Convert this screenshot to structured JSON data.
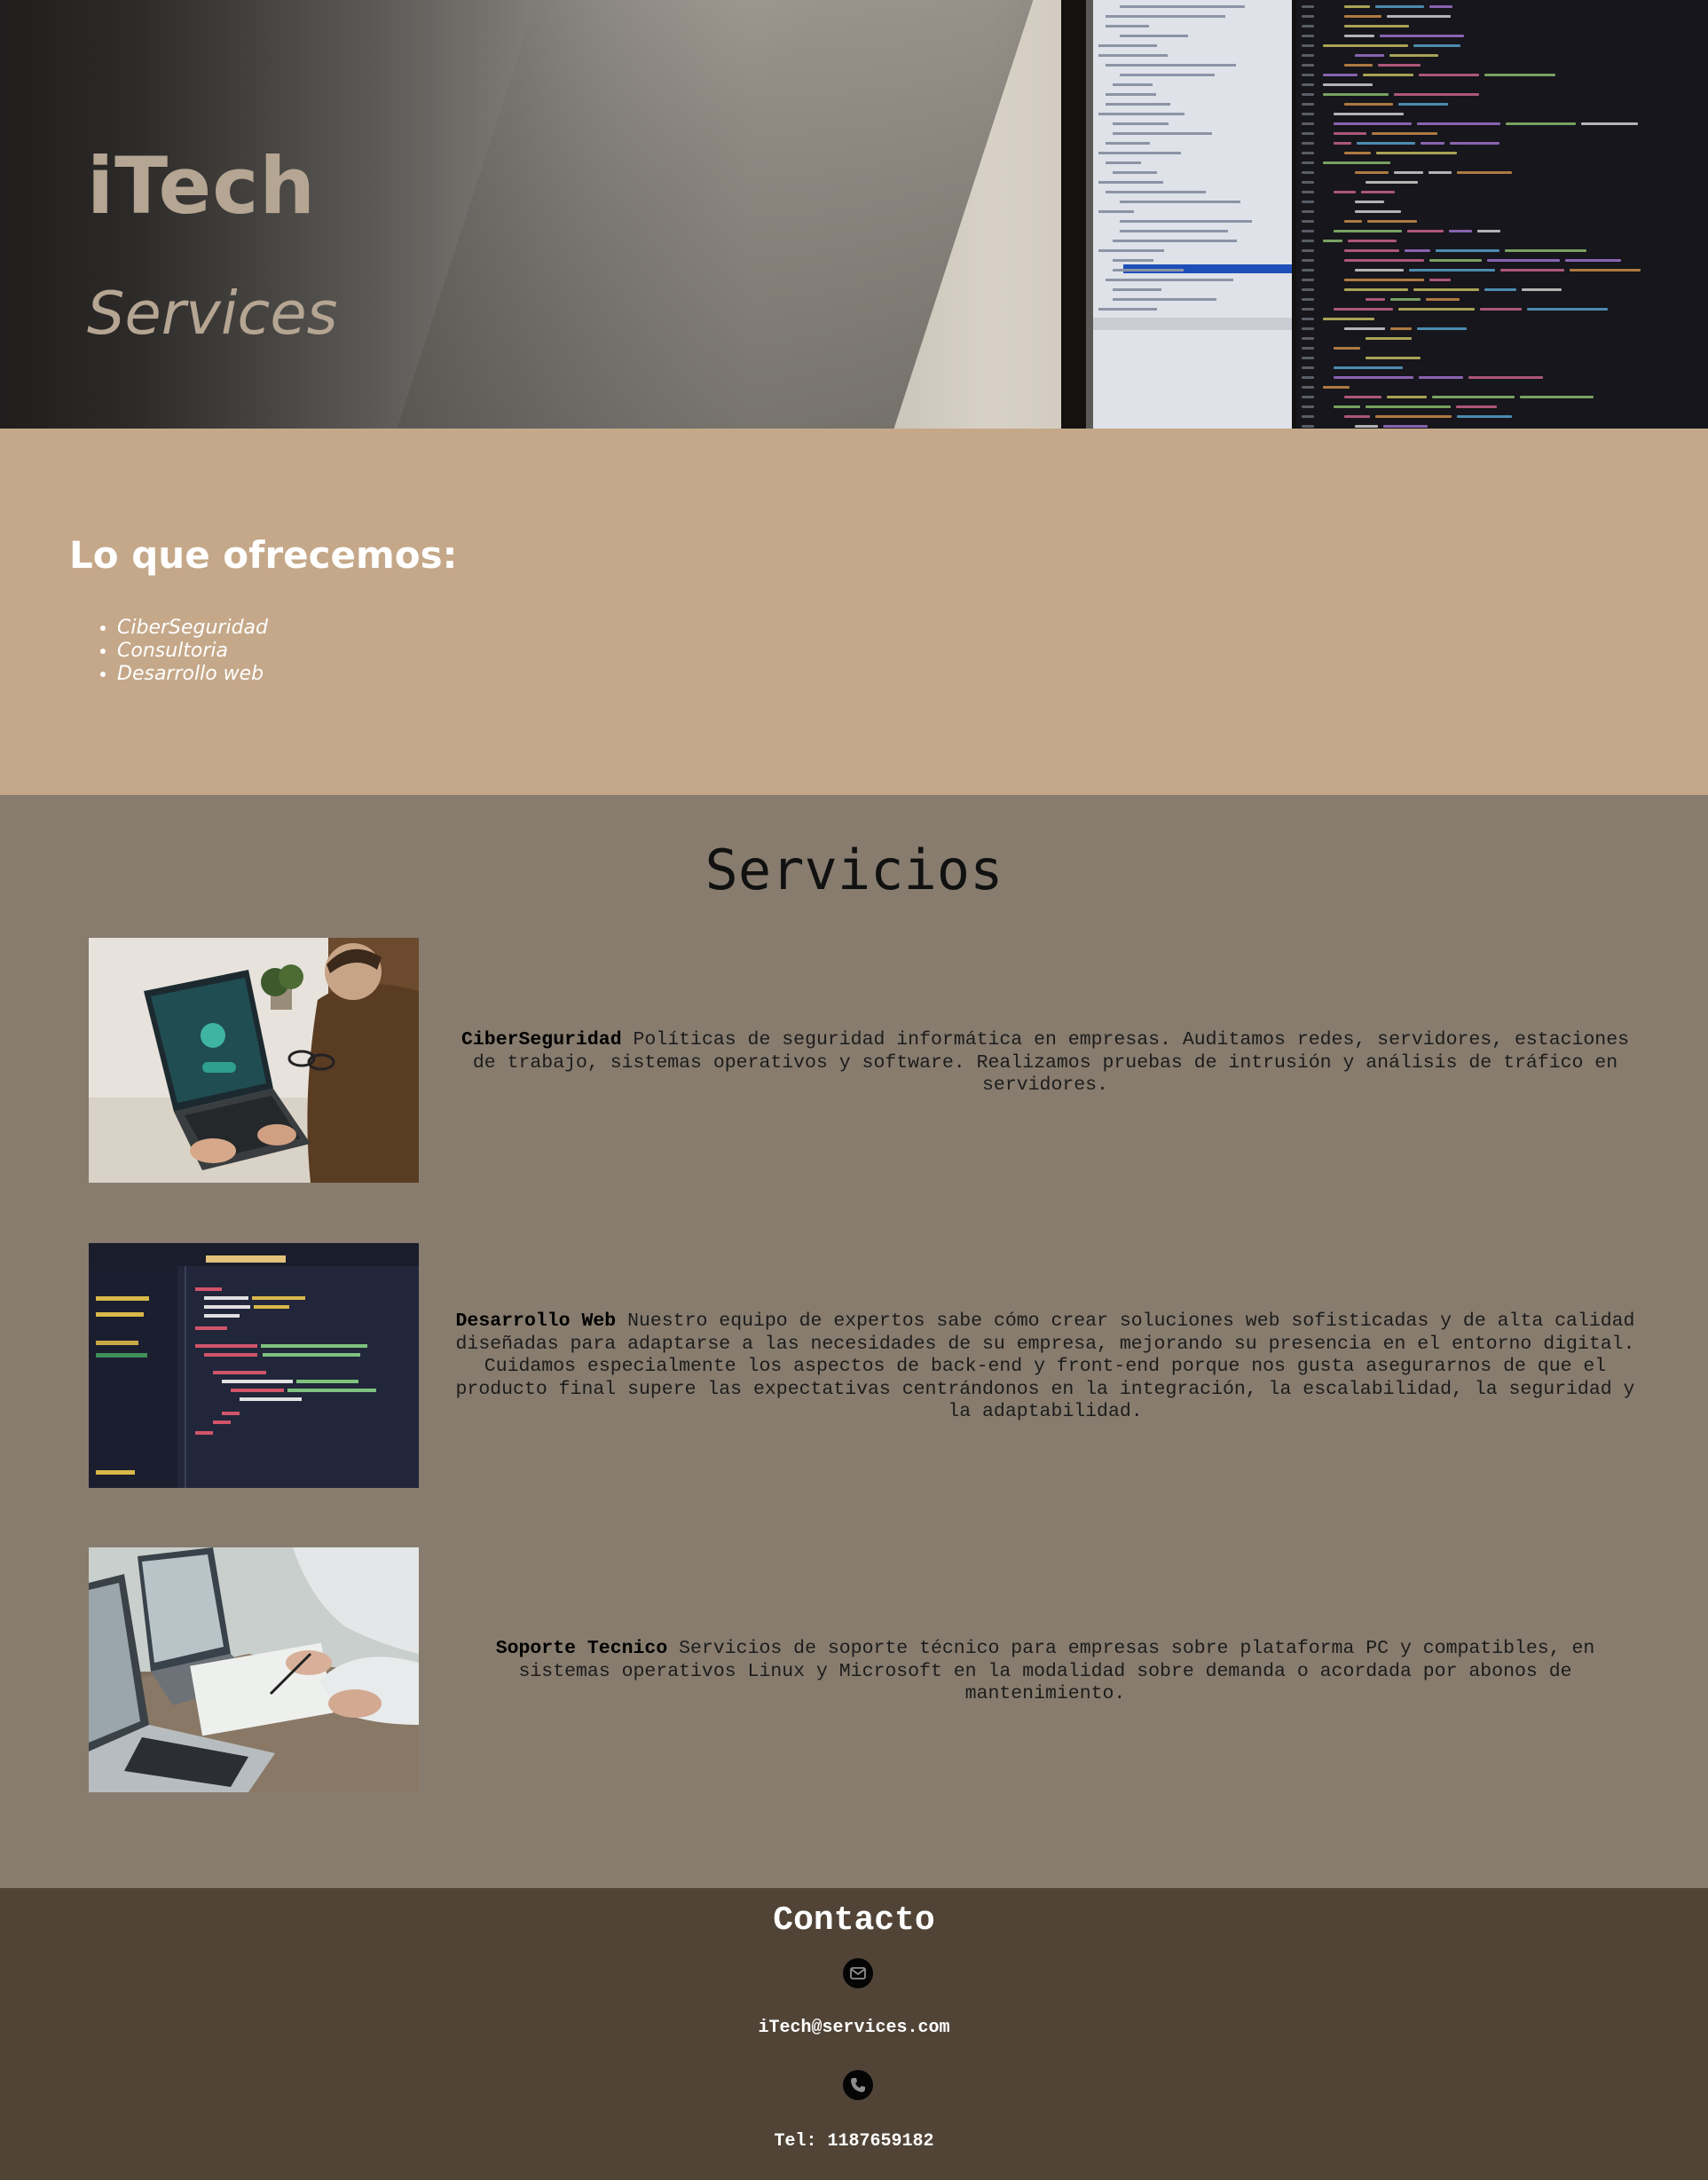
{
  "hero": {
    "brand": "iTech",
    "tagline": "Services"
  },
  "offer": {
    "heading": "Lo que ofrecemos:",
    "items": [
      "CiberSeguridad",
      "Consultoria",
      "Desarrollo web"
    ]
  },
  "services": {
    "title": "Servicios",
    "items": [
      {
        "name": "CiberSeguridad",
        "description": "Políticas de seguridad informática en empresas. Auditamos redes, servidores, estaciones de trabajo, sistemas operativos y software. Realizamos pruebas de intrusión y análisis de tráfico en servidores.",
        "image": "laptop-security-photo"
      },
      {
        "name": "Desarrollo Web",
        "description": "Nuestro equipo de expertos sabe cómo crear soluciones web sofisticadas y de alta calidad diseñadas para adaptarse a las necesidades de su empresa, mejorando su presencia en el entorno digital. Cuidamos especialmente los aspectos de back-end y front-end porque nos gusta asegurarnos de que el producto final supere las expectativas centrándonos en la integración, la escalabilidad, la seguridad y la adaptabilidad.",
        "image": "code-editor-photo"
      },
      {
        "name": "Soporte Tecnico",
        "description": "Servicios de soporte técnico para empresas sobre plataforma PC y compatibles, en sistemas operativos Linux y Microsoft en la modalidad sobre demanda o acordada por abonos de mantenimiento.",
        "image": "laptops-meeting-photo"
      }
    ]
  },
  "contact": {
    "heading": "Contacto",
    "email": "iTech@services.com",
    "phone": "Tel: 1187659182",
    "email_icon": "envelope-icon",
    "phone_icon": "phone-icon"
  },
  "colors": {
    "brand_text": "#b5a593",
    "offer_bg": "#c5a889",
    "services_bg": "#877c6e",
    "contact_bg": "#514437"
  }
}
